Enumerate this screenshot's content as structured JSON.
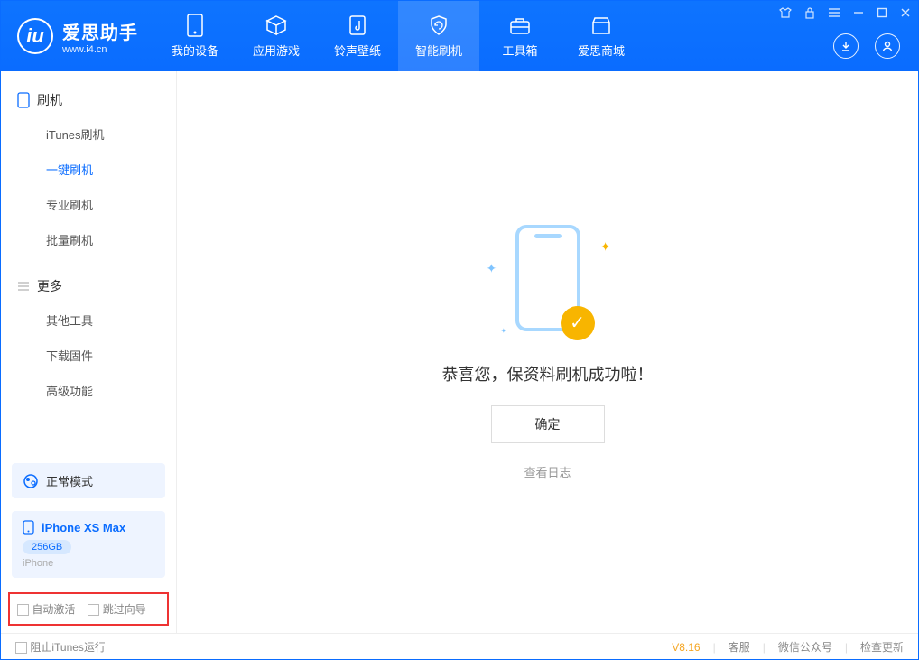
{
  "app": {
    "title": "爱思助手",
    "subtitle": "www.i4.cn"
  },
  "tabs": {
    "device": "我的设备",
    "apps": "应用游戏",
    "ring": "铃声壁纸",
    "flash": "智能刷机",
    "tools": "工具箱",
    "store": "爱思商城"
  },
  "sidebar": {
    "section1": "刷机",
    "items1": {
      "itunes": "iTunes刷机",
      "oneclick": "一键刷机",
      "pro": "专业刷机",
      "batch": "批量刷机"
    },
    "section2": "更多",
    "items2": {
      "other": "其他工具",
      "firmware": "下载固件",
      "advanced": "高级功能"
    }
  },
  "mode": {
    "label": "正常模式"
  },
  "device": {
    "name": "iPhone XS Max",
    "storage": "256GB",
    "type": "iPhone"
  },
  "options": {
    "auto_activate": "自动激活",
    "skip_guide": "跳过向导"
  },
  "main": {
    "message": "恭喜您，保资料刷机成功啦！",
    "ok": "确定",
    "log": "查看日志"
  },
  "footer": {
    "block_itunes": "阻止iTunes运行",
    "version": "V8.16",
    "service": "客服",
    "wechat": "微信公众号",
    "update": "检查更新"
  }
}
